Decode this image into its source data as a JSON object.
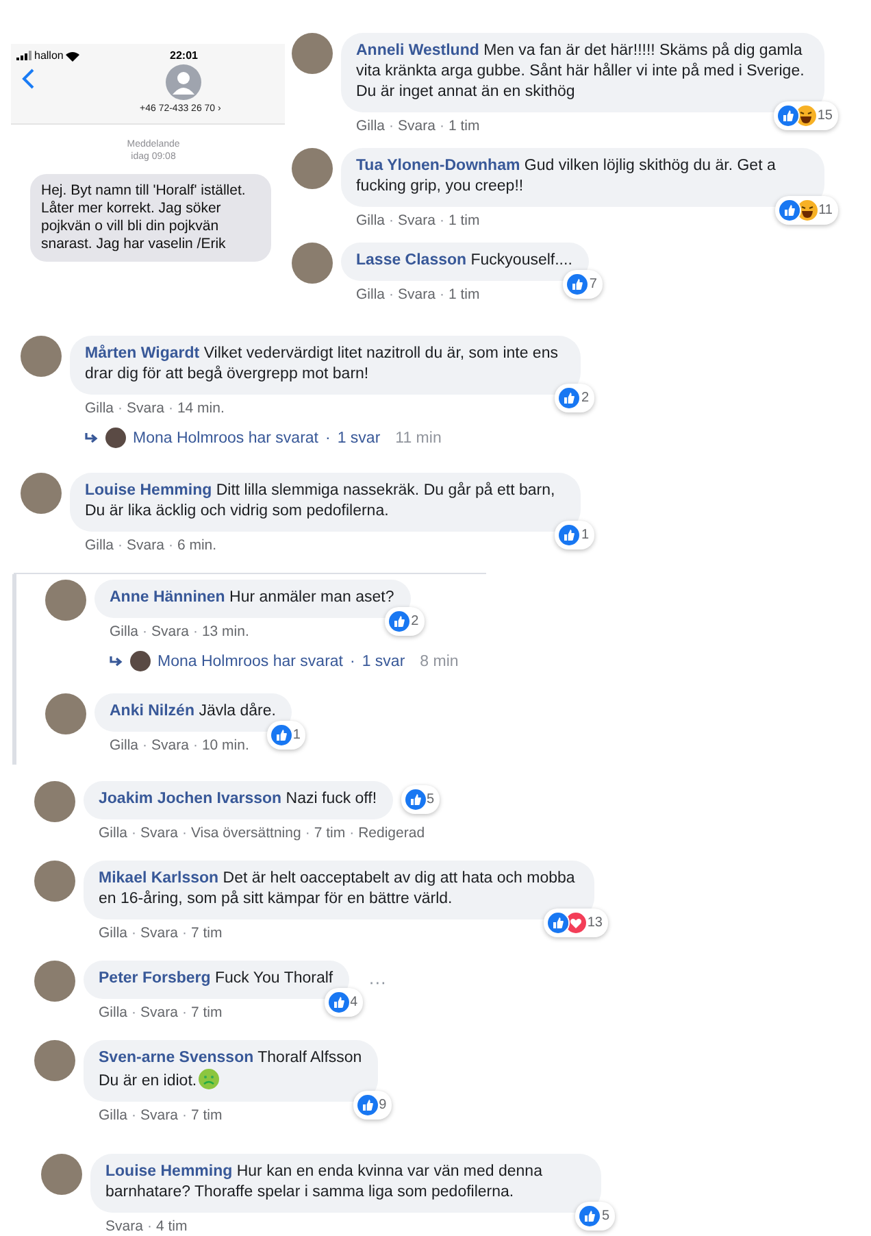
{
  "separator": "·",
  "sms": {
    "carrier": "hallon",
    "time": "22:01",
    "contact": "+46 72-433 26 70 ›",
    "label": "Meddelande",
    "date": "idag 09:08",
    "message": "Hej. Byt namn till 'Horalf' istället. Låter mer korrekt. Jag söker pojkvän o vill bli din pojkvän snarast. Jag har vaselin /Erik"
  },
  "top_comments": [
    {
      "name": "Anneli Westlund",
      "text": "Men va fan är det här!!!!! Skäms på dig gamla vita kränkta arga gubbe. Sånt här håller vi inte på med i Sverige. Du är inget annat än en skithög",
      "reactions": [
        {
          "kind": "like"
        },
        {
          "kind": "haha"
        }
      ],
      "reaction_count": "15",
      "actions": [
        "Gilla",
        "Svara"
      ],
      "time": "1 tim"
    },
    {
      "name": "Tua Ylonen-Downham",
      "text": "Gud vilken löjlig skithög du är. Get a fucking grip, you creep!!",
      "reactions": [
        {
          "kind": "like"
        },
        {
          "kind": "haha"
        }
      ],
      "reaction_count": "11",
      "actions": [
        "Gilla",
        "Svara"
      ],
      "time": "1 tim"
    },
    {
      "name": "Lasse Classon",
      "text": "Fuckyouself....",
      "reactions": [
        {
          "kind": "like"
        }
      ],
      "reaction_count": "7",
      "actions": [
        "Gilla",
        "Svara"
      ],
      "time": "1 tim"
    }
  ],
  "comments": [
    {
      "name": "Mårten Wigardt",
      "text": "Vilket vedervärdigt litet nazitroll du är, som inte ens drar dig för att begå övergrepp mot barn!",
      "reactions": [
        {
          "kind": "like"
        }
      ],
      "reaction_count": "2",
      "actions": [
        "Gilla",
        "Svara"
      ],
      "time": "14 min.",
      "reply_summary": {
        "text": "Mona Holmroos har svarat",
        "count": "1 svar",
        "time": "11 min"
      }
    },
    {
      "name": "Louise Hemming",
      "text": "Ditt lilla slemmiga nassekräk. Du går på ett barn, Du är lika äcklig och vidrig som pedofilerna.",
      "reactions": [
        {
          "kind": "like"
        }
      ],
      "reaction_count": "1",
      "actions": [
        "Gilla",
        "Svara"
      ],
      "time": "6 min."
    }
  ],
  "nested_comments": [
    {
      "name": "Anne Hänninen",
      "text": "Hur anmäler man aset?",
      "reactions": [
        {
          "kind": "like"
        }
      ],
      "reaction_count": "2",
      "actions": [
        "Gilla",
        "Svara"
      ],
      "time": "13 min.",
      "reply_summary": {
        "text": "Mona Holmroos har svarat",
        "count": "1 svar",
        "time": "8 min"
      }
    },
    {
      "name": "Anki Nilzén",
      "text": "Jävla dåre.",
      "reactions": [
        {
          "kind": "like"
        }
      ],
      "reaction_count": "1",
      "actions": [
        "Gilla",
        "Svara"
      ],
      "time": "10 min."
    }
  ],
  "more_comments": [
    {
      "name": "Joakim Jochen Ivarsson",
      "text": "Nazi fuck off!",
      "reactions_beside": true,
      "reactions": [
        {
          "kind": "like"
        }
      ],
      "reaction_count": "5",
      "actions": [
        "Gilla",
        "Svara",
        "Visa översättning"
      ],
      "time": "7 tim",
      "edited": "Redigerad"
    },
    {
      "name": "Mikael Karlsson",
      "text": "Det är helt oacceptabelt av dig att hata och mobba en 16-åring, som på sitt kämpar för en bättre värld.",
      "reactions": [
        {
          "kind": "like"
        },
        {
          "kind": "love"
        }
      ],
      "reaction_count": "13",
      "actions": [
        "Gilla",
        "Svara"
      ],
      "time": "7 tim"
    },
    {
      "name": "Peter Forsberg",
      "text": "Fuck You Thoralf",
      "reactions": [
        {
          "kind": "like"
        }
      ],
      "reaction_count": "4",
      "actions": [
        "Gilla",
        "Svara"
      ],
      "time": "7 tim",
      "more": "···"
    },
    {
      "name": "Sven-arne Svensson",
      "text": "Thoralf Alfsson\nDu är en idiot.",
      "emoji": {
        "kind": "nauseated"
      },
      "reactions": [
        {
          "kind": "like"
        }
      ],
      "reaction_count": "9",
      "actions": [
        "Gilla",
        "Svara"
      ],
      "time": "7 tim"
    },
    {
      "name": "Louise Hemming",
      "text": "Hur kan en enda kvinna var vän med denna barnhatare? Thoraffe spelar i samma liga som pedofilerna.",
      "reactions": [
        {
          "kind": "like"
        }
      ],
      "reaction_count": "5",
      "actions": [
        "Svara"
      ],
      "time": "4 tim"
    }
  ]
}
